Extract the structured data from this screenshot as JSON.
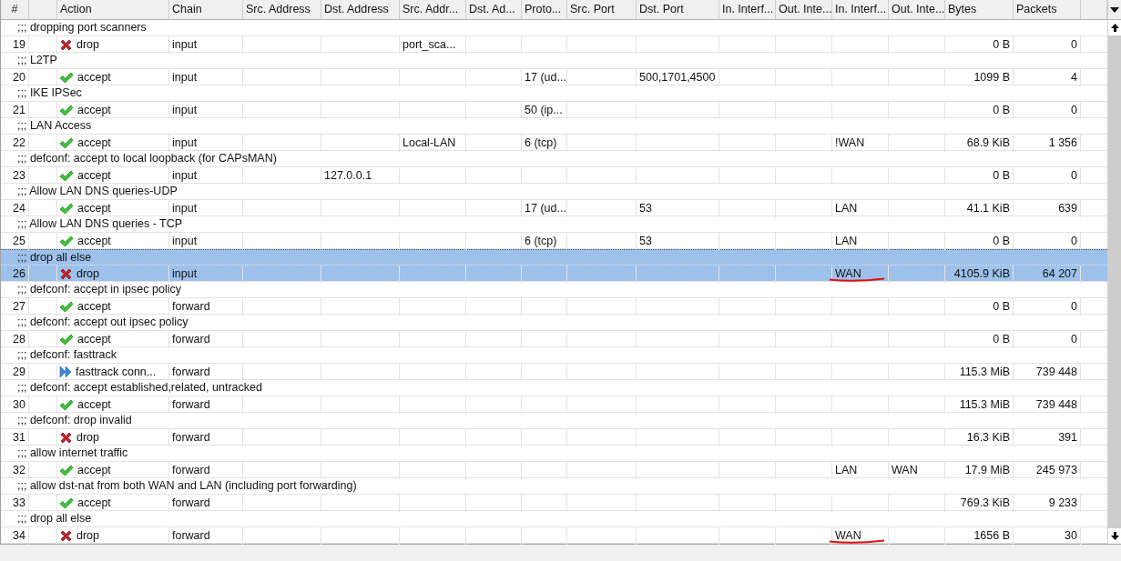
{
  "table": {
    "columns": [
      "#",
      "Action",
      "Chain",
      "Src. Address",
      "Dst. Address",
      "Src. Addr...",
      "Dst. Ad...",
      "Proto...",
      "Src. Port",
      "Dst. Port",
      "In. Interf...",
      "Out. Inte...",
      "In. Interf...",
      "Out. Inte...",
      "Bytes",
      "Packets"
    ],
    "rows": [
      {
        "comment": ";;; dropping port scanners",
        "selected": false,
        "underlined": false,
        "cells": [
          "19",
          {
            "kind": "drop",
            "label": "drop"
          },
          "input",
          null,
          null,
          "port_sca...",
          null,
          null,
          null,
          null,
          null,
          null,
          null,
          null,
          "0 B",
          "0"
        ]
      },
      {
        "comment": ";;; L2TP",
        "selected": false,
        "underlined": false,
        "cells": [
          "20",
          {
            "kind": "accept",
            "label": "accept"
          },
          "input",
          null,
          null,
          null,
          null,
          "17 (ud...",
          null,
          "500,1701,4500",
          null,
          null,
          null,
          null,
          "1099 B",
          "4"
        ]
      },
      {
        "comment": ";;; IKE IPSec",
        "selected": false,
        "underlined": false,
        "cells": [
          "21",
          {
            "kind": "accept",
            "label": "accept"
          },
          "input",
          null,
          null,
          null,
          null,
          "50 (ip...",
          null,
          null,
          null,
          null,
          null,
          null,
          "0 B",
          "0"
        ]
      },
      {
        "comment": ";;; LAN Access",
        "selected": false,
        "underlined": false,
        "cells": [
          "22",
          {
            "kind": "accept",
            "label": "accept"
          },
          "input",
          null,
          null,
          "Local-LAN",
          null,
          "6 (tcp)",
          null,
          null,
          null,
          null,
          "!WAN",
          null,
          "68.9 KiB",
          "1 356"
        ]
      },
      {
        "comment": ";;; defconf: accept to local loopback (for CAPsMAN)",
        "selected": false,
        "underlined": false,
        "cells": [
          "23",
          {
            "kind": "accept",
            "label": "accept"
          },
          "input",
          null,
          "127.0.0.1",
          null,
          null,
          null,
          null,
          null,
          null,
          null,
          null,
          null,
          "0 B",
          "0"
        ]
      },
      {
        "comment": ";;; Allow LAN DNS queries-UDP",
        "selected": false,
        "underlined": false,
        "cells": [
          "24",
          {
            "kind": "accept",
            "label": "accept"
          },
          "input",
          null,
          null,
          null,
          null,
          "17 (ud...",
          null,
          "53",
          null,
          null,
          "LAN",
          null,
          "41.1 KiB",
          "639"
        ]
      },
      {
        "comment": ";;; Allow LAN DNS queries - TCP",
        "selected": false,
        "underlined": false,
        "cells": [
          "25",
          {
            "kind": "accept",
            "label": "accept"
          },
          "input",
          null,
          null,
          null,
          null,
          "6 (tcp)",
          null,
          "53",
          null,
          null,
          "LAN",
          null,
          "0 B",
          "0"
        ]
      },
      {
        "comment": ";;; drop all else",
        "selected": true,
        "underlined": true,
        "cells": [
          "26",
          {
            "kind": "drop",
            "label": "drop"
          },
          "input",
          null,
          null,
          null,
          null,
          null,
          null,
          null,
          null,
          null,
          "WAN",
          null,
          "4105.9 KiB",
          "64 207"
        ]
      },
      {
        "comment": ";;; defconf: accept in ipsec policy",
        "selected": false,
        "underlined": false,
        "cells": [
          "27",
          {
            "kind": "accept",
            "label": "accept"
          },
          "forward",
          null,
          null,
          null,
          null,
          null,
          null,
          null,
          null,
          null,
          null,
          null,
          "0 B",
          "0"
        ]
      },
      {
        "comment": ";;; defconf: accept out ipsec policy",
        "selected": false,
        "underlined": false,
        "cells": [
          "28",
          {
            "kind": "accept",
            "label": "accept"
          },
          "forward",
          null,
          null,
          null,
          null,
          null,
          null,
          null,
          null,
          null,
          null,
          null,
          "0 B",
          "0"
        ]
      },
      {
        "comment": ";;; defconf: fasttrack",
        "selected": false,
        "underlined": false,
        "cells": [
          "29",
          {
            "kind": "fasttrack",
            "label": "fasttrack conn..."
          },
          "forward",
          null,
          null,
          null,
          null,
          null,
          null,
          null,
          null,
          null,
          null,
          null,
          "115.3 MiB",
          "739 448"
        ]
      },
      {
        "comment": ";;; defconf: accept established,related, untracked",
        "selected": false,
        "underlined": false,
        "cells": [
          "30",
          {
            "kind": "accept",
            "label": "accept"
          },
          "forward",
          null,
          null,
          null,
          null,
          null,
          null,
          null,
          null,
          null,
          null,
          null,
          "115.3 MiB",
          "739 448"
        ]
      },
      {
        "comment": ";;; defconf: drop invalid",
        "selected": false,
        "underlined": false,
        "cells": [
          "31",
          {
            "kind": "drop",
            "label": "drop"
          },
          "forward",
          null,
          null,
          null,
          null,
          null,
          null,
          null,
          null,
          null,
          null,
          null,
          "16.3 KiB",
          "391"
        ]
      },
      {
        "comment": ";;; allow internet traffic",
        "selected": false,
        "underlined": false,
        "cells": [
          "32",
          {
            "kind": "accept",
            "label": "accept"
          },
          "forward",
          null,
          null,
          null,
          null,
          null,
          null,
          null,
          null,
          null,
          "LAN",
          "WAN",
          "17.9 MiB",
          "245 973"
        ]
      },
      {
        "comment": ";;; allow dst-nat from both WAN and LAN (including port forwarding)",
        "selected": false,
        "underlined": false,
        "cells": [
          "33",
          {
            "kind": "accept",
            "label": "accept"
          },
          "forward",
          null,
          null,
          null,
          null,
          null,
          null,
          null,
          null,
          null,
          null,
          null,
          "769.3 KiB",
          "9 233"
        ]
      },
      {
        "comment": ";;; drop all else",
        "selected": false,
        "underlined": true,
        "cells": [
          "34",
          {
            "kind": "drop",
            "label": "drop"
          },
          "forward",
          null,
          null,
          null,
          null,
          null,
          null,
          null,
          null,
          null,
          "WAN",
          null,
          "1656 B",
          "30"
        ]
      }
    ]
  }
}
